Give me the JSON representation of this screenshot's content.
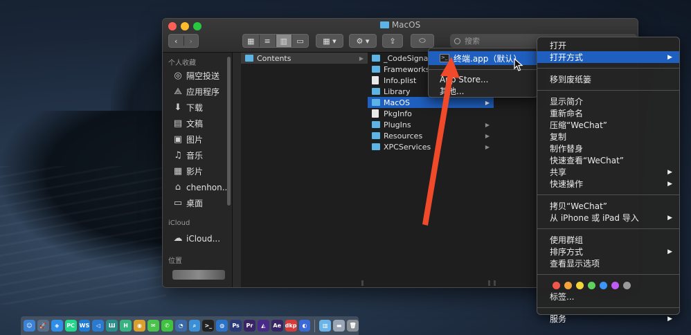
{
  "window": {
    "title": "MacOS",
    "search_placeholder": "搜索"
  },
  "toolbar": {
    "back_icon": "‹",
    "forward_icon": "›",
    "view_icons": [
      "▦",
      "≡",
      "▥",
      "▭"
    ],
    "group_icon": "▦ ▾",
    "action_icon": "⚙ ▾",
    "share_icon": "⇪",
    "tag_icon": "⬭"
  },
  "sidebar": {
    "favorites_heading": "个人收藏",
    "favorites": [
      {
        "icon": "◎",
        "label": "隔空投送"
      },
      {
        "icon": "⟁",
        "label": "应用程序"
      },
      {
        "icon": "⬇",
        "label": "下载"
      },
      {
        "icon": "▤",
        "label": "文稿"
      },
      {
        "icon": "▣",
        "label": "图片"
      },
      {
        "icon": "♫",
        "label": "音乐"
      },
      {
        "icon": "▦",
        "label": "影片"
      },
      {
        "icon": "⌂",
        "label": "chenhon..."
      },
      {
        "icon": "▭",
        "label": "桌面"
      }
    ],
    "icloud_heading": "iCloud",
    "icloud_items": [
      {
        "icon": "☁",
        "label": "iCloud..."
      }
    ],
    "locations_heading": "位置"
  },
  "columns": {
    "col1": [
      {
        "label": "Contents",
        "type": "folder"
      }
    ],
    "col2": [
      {
        "label": "_CodeSignature",
        "type": "folder"
      },
      {
        "label": "Frameworks",
        "type": "folder"
      },
      {
        "label": "Info.plist",
        "type": "doc"
      },
      {
        "label": "Library",
        "type": "folder"
      },
      {
        "label": "MacOS",
        "type": "folder"
      },
      {
        "label": "PkgInfo",
        "type": "doc"
      },
      {
        "label": "PlugIns",
        "type": "folder"
      },
      {
        "label": "Resources",
        "type": "folder"
      },
      {
        "label": "XPCServices",
        "type": "folder"
      }
    ]
  },
  "submenu": {
    "default_app": "终端.app（默认）",
    "app_store": "App Store...",
    "other": "其他..."
  },
  "context_menu": {
    "open": "打开",
    "open_with": "打开方式",
    "move_to_trash": "移到废纸篓",
    "get_info": "显示简介",
    "rename": "重新命名",
    "compress": "压缩“WeChat”",
    "duplicate": "复制",
    "make_alias": "制作替身",
    "quick_look": "快速查看“WeChat”",
    "share": "共享",
    "quick_actions": "快速操作",
    "copy": "拷贝“WeChat”",
    "import_from_iphone": "从 iPhone 或 iPad 导入",
    "use_groups": "使用群组",
    "sort_by": "排序方式",
    "show_view_options": "查看显示选项",
    "tags_label": "标签...",
    "services": "服务",
    "tag_colors": [
      "#f0574a",
      "#f5a33b",
      "#f5d33b",
      "#5ed35b",
      "#3b96f5",
      "#bf5af2",
      "#9a9a9a"
    ]
  },
  "dock": {
    "icons": [
      {
        "name": "finder",
        "color": "#3b82d6",
        "glyph": "☺"
      },
      {
        "name": "launchpad",
        "color": "#5a6d88",
        "glyph": "🚀"
      },
      {
        "name": "safari",
        "color": "#2f8fe8",
        "glyph": "◈"
      },
      {
        "name": "pycharm",
        "color": "#21d789",
        "glyph": "PC"
      },
      {
        "name": "webstorm",
        "color": "#1e7bd6",
        "glyph": "WS"
      },
      {
        "name": "vscode",
        "color": "#2b7ad1",
        "glyph": "◁"
      },
      {
        "name": "notes",
        "color": "#2a8f8a",
        "glyph": "Ш"
      },
      {
        "name": "hbuilder",
        "color": "#36b37e",
        "glyph": "H"
      },
      {
        "name": "chrome",
        "color": "#d9a030",
        "glyph": "◉"
      },
      {
        "name": "messages",
        "color": "#4cc14c",
        "glyph": "✉"
      },
      {
        "name": "wechat",
        "color": "#3fc23f",
        "glyph": "✆"
      },
      {
        "name": "proxy",
        "color": "#3a6aa8",
        "glyph": "◔"
      },
      {
        "name": "search",
        "color": "#3b8fd6",
        "glyph": "⌕"
      },
      {
        "name": "terminal",
        "color": "#222222",
        "glyph": ">_"
      },
      {
        "name": "maps",
        "color": "#2a73c8",
        "glyph": "◍"
      },
      {
        "name": "photoshop",
        "color": "#2b3a78",
        "glyph": "Ps"
      },
      {
        "name": "premiere",
        "color": "#3a2468",
        "glyph": "Pr"
      },
      {
        "name": "vectorizer",
        "color": "#4a2a88",
        "glyph": "◭"
      },
      {
        "name": "after-effects",
        "color": "#382566",
        "glyph": "Ae"
      },
      {
        "name": "tool",
        "color": "#d83a3a",
        "glyph": "dkp"
      },
      {
        "name": "browser",
        "color": "#3a6ad8",
        "glyph": "◐"
      },
      {
        "name": "downloads-folder",
        "color": "#6ab4e8",
        "glyph": "▥"
      },
      {
        "name": "stack",
        "color": "#9aa6b6",
        "glyph": "▬"
      },
      {
        "name": "trash",
        "color": "#8a8f96",
        "glyph": "🗑"
      }
    ]
  }
}
